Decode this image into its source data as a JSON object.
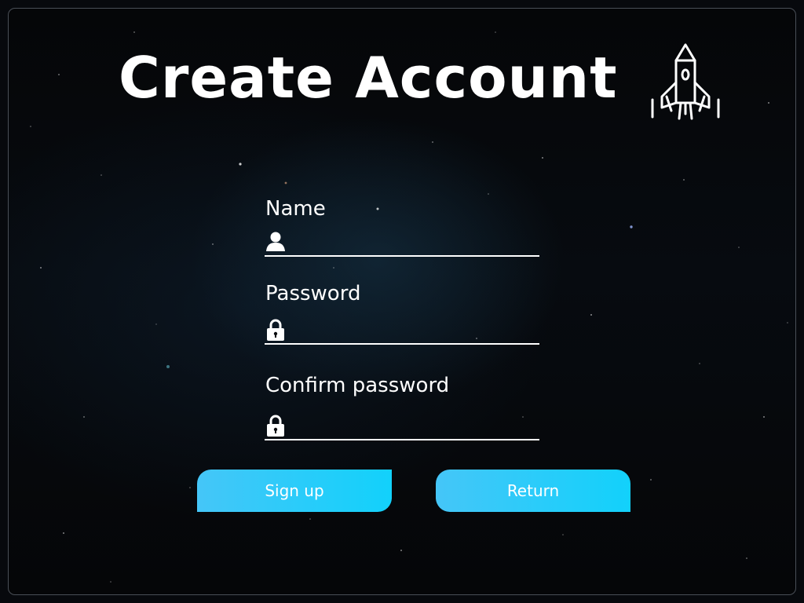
{
  "title": "Create Account",
  "fields": {
    "name": {
      "label": "Name",
      "value": "",
      "placeholder": "",
      "icon": "user-icon"
    },
    "password": {
      "label": "Password",
      "value": "",
      "placeholder": "",
      "icon": "lock-icon"
    },
    "confirm_password": {
      "label": "Confirm password",
      "value": "",
      "placeholder": "",
      "icon": "lock-icon"
    }
  },
  "buttons": {
    "signup_label": "Sign up",
    "return_label": "Return"
  },
  "decor": {
    "title_icon": "rocket-icon"
  },
  "colors": {
    "background": "#07090d",
    "text": "#ffffff",
    "button_gradient_start": "#45c6f8",
    "button_gradient_end": "#12d1fb"
  }
}
